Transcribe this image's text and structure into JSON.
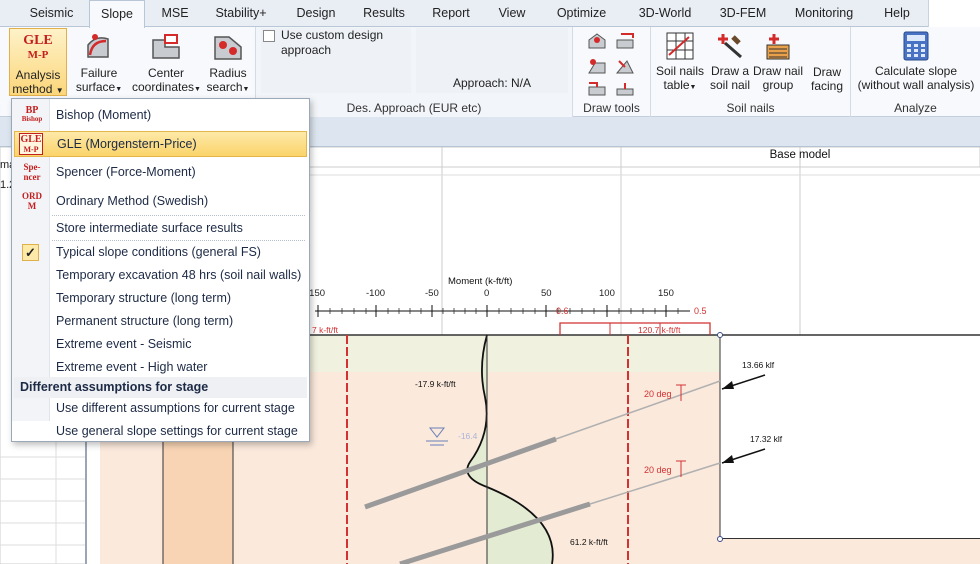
{
  "tabs": [
    "Seismic",
    "Slope",
    "MSE",
    "Stability+",
    "Design",
    "Results",
    "Report",
    "View",
    "Optimize",
    "3D-World",
    "3D-FEM",
    "Monitoring",
    "Help"
  ],
  "active_tab": "Slope",
  "ribbon": {
    "analysis_method": {
      "icon_line1": "GLE",
      "icon_line2": "M-P",
      "label_line1": "Analysis",
      "label_line2": "method"
    },
    "failure_surface": {
      "line1": "Failure",
      "line2": "surface"
    },
    "center_coordinates": {
      "line1": "Center",
      "line2": "coordinates"
    },
    "radius_search": {
      "line1": "Radius",
      "line2": "search"
    },
    "custom_design": "Use custom design approach",
    "approach": "Approach: N/A",
    "des_approach_label": "Des. Approach (EUR etc)",
    "draw_tools_label": "Draw tools",
    "soil_nails_table": {
      "line1": "Soil nails",
      "line2": "table"
    },
    "draw_soil_nail": {
      "line1": "Draw a",
      "line2": "soil nail"
    },
    "draw_nail_group": {
      "line1": "Draw nail",
      "line2": "group"
    },
    "draw_facing": {
      "line1": "Draw",
      "line2": "facing"
    },
    "soil_nails_label": "Soil nails",
    "calculate_slope": {
      "line1": "Calculate slope",
      "line2": "(without wall analysis)"
    },
    "analyze_label": "Analyze"
  },
  "dropdown": {
    "methods": [
      {
        "icon_line1": "BP",
        "icon_line2": "Bishop",
        "label": "Bishop (Moment)"
      },
      {
        "icon_line1": "GLE",
        "icon_line2": "M-P",
        "label": "GLE (Morgenstern-Price)"
      },
      {
        "icon_line1": "Spe-",
        "icon_line2": "ncer",
        "label": "Spencer (Force-Moment)"
      },
      {
        "icon_line1": "ORD",
        "icon_line2": "M",
        "label": "Ordinary Method (Swedish)"
      }
    ],
    "selected_method": "GLE (Morgenstern-Price)",
    "store_intermediate": "Store intermediate surface results",
    "conditions": [
      "Typical slope conditions (general FS)",
      "Temporary excavation 48 hrs (soil nail walls)",
      "Temporary structure (long term)",
      "Permanent structure (long term)",
      "Extreme event - Seismic",
      "Extreme event - High water"
    ],
    "checked_condition": "Typical slope conditions (general FS)",
    "section_header": "Different assumptions for stage",
    "stage_options": [
      "Use different assumptions for current stage",
      "Use general slope settings for current stage"
    ]
  },
  "canvas": {
    "header": "Base model",
    "left_fragments": [
      "ma",
      "1.2"
    ],
    "moment_axis_label": "Moment (k-ft/ft)",
    "moment_ticks": [
      "-150",
      "-100",
      "-50",
      "0",
      "50",
      "100",
      "150"
    ],
    "red_values": [
      "0.6",
      "0.5"
    ],
    "left_moment_label": "7 k-ft/ft",
    "right_moment_label": "120.7 k-ft/ft",
    "min_moment_label": "-17.9 k-ft/ft",
    "max_moment_label": "61.2 k-ft/ft",
    "water_label": "-16.4",
    "nail_angle_1": "20 deg",
    "nail_angle_2": "20 deg",
    "force_1": "13.66 klf",
    "force_2": "17.32 klf"
  },
  "colors": {
    "ribbon_bg": "#f7f9fc",
    "tab_bar": "#e9eef5",
    "selected_item": "#fbd46a",
    "soil_upper": "#f1f1e0",
    "soil_lower": "#fbe9dc",
    "moment_fill": "#e3ecd3",
    "red_line": "#d23232"
  }
}
